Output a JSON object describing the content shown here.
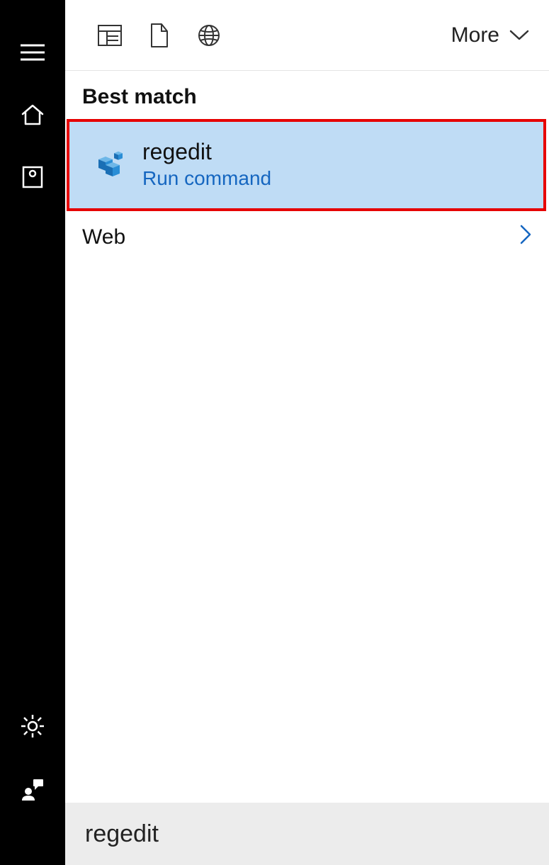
{
  "top_filters": {
    "more_label": "More"
  },
  "sections": {
    "best_match": "Best match",
    "web": "Web"
  },
  "result": {
    "title": "regedit",
    "subtitle": "Run command"
  },
  "search": {
    "value": "regedit"
  }
}
